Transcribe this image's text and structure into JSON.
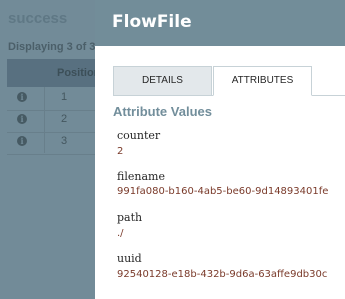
{
  "background": {
    "queue_title": "success",
    "listing_text": "Displaying 3 of 3",
    "column_position": "Position",
    "rows": [
      {
        "position": "1",
        "info_icon": "info-icon"
      },
      {
        "position": "2",
        "info_icon": "info-icon"
      },
      {
        "position": "3",
        "info_icon": "info-icon"
      }
    ]
  },
  "dialog": {
    "title": "FlowFile",
    "tabs": [
      {
        "label": "DETAILS",
        "active": false
      },
      {
        "label": "ATTRIBUTES",
        "active": true
      }
    ],
    "section_title": "Attribute Values",
    "attributes": [
      {
        "name": "counter",
        "value": "2"
      },
      {
        "name": "filename",
        "value": "991fa080-b160-4ab5-be60-9d14893401fe"
      },
      {
        "name": "path",
        "value": "./"
      },
      {
        "name": "uuid",
        "value": "92540128-e18b-432b-9d6a-63affe9db30c"
      }
    ]
  },
  "colors": {
    "header": "#728d99",
    "value_text": "#7a3a2a",
    "section_title": "#728e9b"
  }
}
